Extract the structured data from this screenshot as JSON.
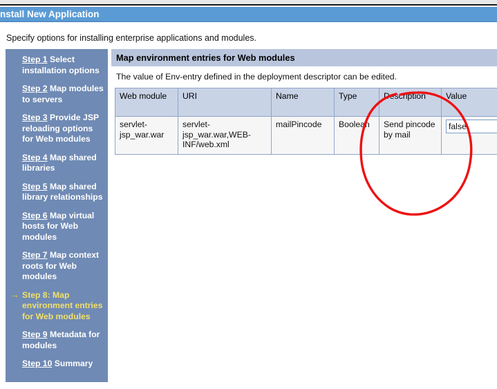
{
  "window": {
    "title": "nstall New Application"
  },
  "intro": {
    "text": "Specify options for installing enterprise applications and modules."
  },
  "sidebar": {
    "steps": [
      {
        "link": "Step 1",
        "rest": " Select installation options",
        "active": false
      },
      {
        "link": "Step 2",
        "rest": " Map modules to servers",
        "active": false
      },
      {
        "link": "Step 3",
        "rest": " Provide JSP reloading options for Web modules",
        "active": false
      },
      {
        "link": "Step 4",
        "rest": " Map shared libraries",
        "active": false
      },
      {
        "link": "Step 5",
        "rest": " Map shared library relationships",
        "active": false
      },
      {
        "link": "Step 6",
        "rest": " Map virtual hosts for Web modules",
        "active": false
      },
      {
        "link": "Step 7",
        "rest": " Map context roots for Web modules",
        "active": false
      },
      {
        "link": "Step 8:",
        "rest": " Map environment entries for Web modules",
        "active": true
      },
      {
        "link": "Step 9",
        "rest": " Metadata for modules",
        "active": false
      },
      {
        "link": "Step 10",
        "rest": " Summary",
        "active": false
      }
    ],
    "active_marker": "→"
  },
  "panel": {
    "header": "Map environment entries for Web modules",
    "description": "The value of Env-entry defined in the deployment descriptor can be edited.",
    "table": {
      "columns": [
        "Web module",
        "URI",
        "Name",
        "Type",
        "Description",
        "Value"
      ],
      "rows": [
        {
          "web_module": "servlet-jsp_war.war",
          "uri": "servlet-jsp_war.war,WEB-INF/web.xml",
          "name": "mailPincode",
          "type": "Boolean",
          "description": "Send pincode by mail",
          "value": "false"
        }
      ]
    }
  },
  "annotation": {
    "shape": "hand-drawn-red-ellipse",
    "color": "#ee1111"
  },
  "colors": {
    "titlebar": "#5b9bd5",
    "sidebar": "#6f8ab4",
    "panel_header": "#b9c5dc",
    "table_header": "#c9d3e6",
    "active_step": "#f2e06a",
    "annotation_red": "#ee1111"
  }
}
